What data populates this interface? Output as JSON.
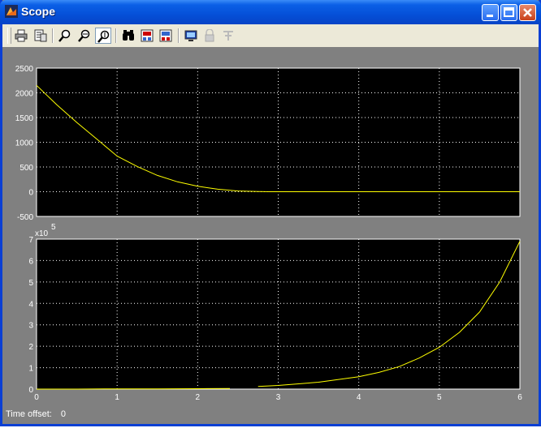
{
  "window": {
    "title": "Scope"
  },
  "toolbar": {
    "buttons": [
      {
        "name": "print",
        "icon": "printer-icon"
      },
      {
        "name": "parameters",
        "icon": "parameters-icon"
      },
      {
        "name": "zoom",
        "icon": "zoom-icon"
      },
      {
        "name": "zoom-x",
        "icon": "zoom-x-icon"
      },
      {
        "name": "zoom-y",
        "icon": "zoom-y-icon"
      },
      {
        "name": "autoscale",
        "icon": "binoculars-icon"
      },
      {
        "name": "save-axes",
        "icon": "save-axes-icon"
      },
      {
        "name": "restore-axes",
        "icon": "restore-axes-icon"
      },
      {
        "name": "floating-scope",
        "icon": "floating-scope-icon"
      },
      {
        "name": "lock-axes",
        "icon": "lock-icon"
      },
      {
        "name": "signal-selection",
        "icon": "signal-selection-icon"
      }
    ]
  },
  "status": {
    "label": "Time offset:",
    "value": "0"
  },
  "colors": {
    "trace": "#ffff00",
    "plot_bg": "#000000",
    "frame_bg": "#808080"
  },
  "chart_data": [
    {
      "type": "line",
      "xlim": [
        0,
        6
      ],
      "ylim": [
        -500,
        2500
      ],
      "yticks": [
        "-500",
        "0",
        "500",
        "1000",
        "1500",
        "2000",
        "2500"
      ],
      "xticks": [
        "0",
        "1",
        "2",
        "3",
        "4",
        "5",
        "6"
      ],
      "grid": true,
      "series": [
        {
          "x": [
            0,
            0.25,
            0.5,
            0.75,
            1.0,
            1.25,
            1.5,
            1.75,
            2.0,
            2.25,
            2.5,
            2.75,
            2.9,
            3.0,
            4.0,
            5.0,
            6.0
          ],
          "y": [
            2150,
            1760,
            1400,
            1060,
            720,
            510,
            330,
            200,
            110,
            50,
            15,
            3,
            0,
            0,
            0,
            0,
            0
          ]
        }
      ]
    },
    {
      "type": "line",
      "xlim": [
        0,
        6
      ],
      "ylim": [
        0,
        7
      ],
      "exponent_label": "x10",
      "exponent_power": "5",
      "yticks": [
        "0",
        "1",
        "2",
        "3",
        "4",
        "5",
        "6",
        "7"
      ],
      "xticks": [
        "0",
        "1",
        "2",
        "3",
        "4",
        "5",
        "6"
      ],
      "grid": true,
      "series": [
        {
          "x": [
            0.0,
            0.5,
            1.0,
            1.5,
            2.0,
            2.4
          ],
          "y": [
            0.0,
            0.0,
            0.01,
            0.01,
            0.02,
            0.03
          ]
        },
        {
          "x": [
            2.75,
            3.0,
            3.5,
            4.0,
            4.25,
            4.5,
            4.75,
            5.0,
            5.25,
            5.5,
            5.75,
            6.0
          ],
          "y": [
            0.12,
            0.17,
            0.32,
            0.58,
            0.78,
            1.05,
            1.45,
            1.95,
            2.65,
            3.6,
            5.0,
            6.9
          ]
        }
      ]
    }
  ]
}
